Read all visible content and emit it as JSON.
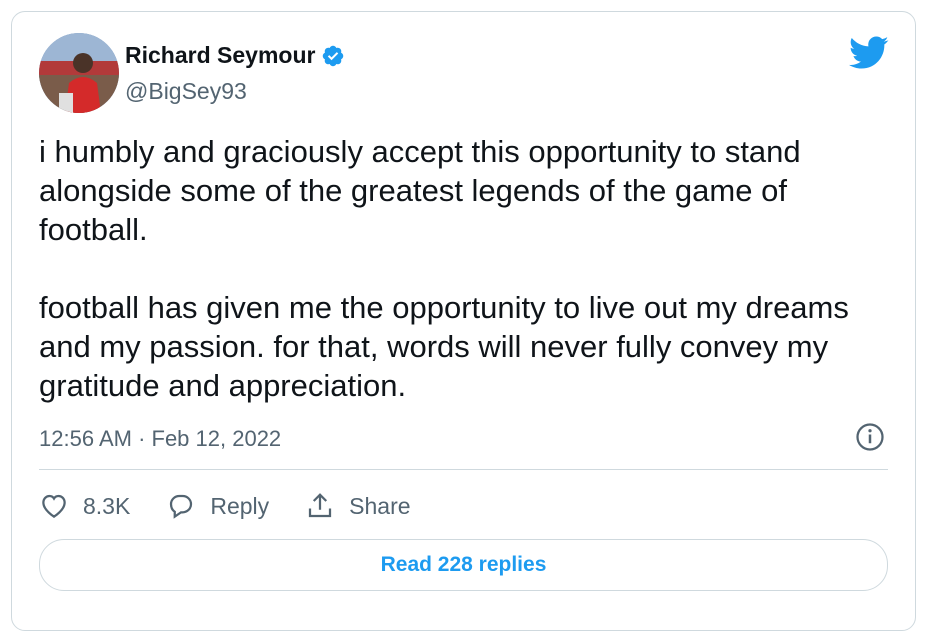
{
  "author": {
    "display_name": "Richard Seymour",
    "handle": "@BigSey93",
    "verified": true
  },
  "tweet": {
    "paragraphs": [
      "i humbly and graciously accept this opportunity to stand alongside some of the greatest legends of the game of football.",
      "football has given me the opportunity to live out my dreams and my passion. for that, words will never fully convey my gratitude and appreciation."
    ],
    "timestamp": "12:56 AM · Feb 12, 2022"
  },
  "actions": {
    "like_count": "8.3K",
    "reply_label": "Reply",
    "share_label": "Share"
  },
  "read_replies_label": "Read 228 replies",
  "colors": {
    "accent": "#1d9bf0",
    "secondary_text": "#536471",
    "border": "#cfd9de"
  },
  "icons": [
    "verified-badge-icon",
    "twitter-bird-icon",
    "info-icon",
    "heart-icon",
    "reply-bubble-icon",
    "share-icon"
  ]
}
